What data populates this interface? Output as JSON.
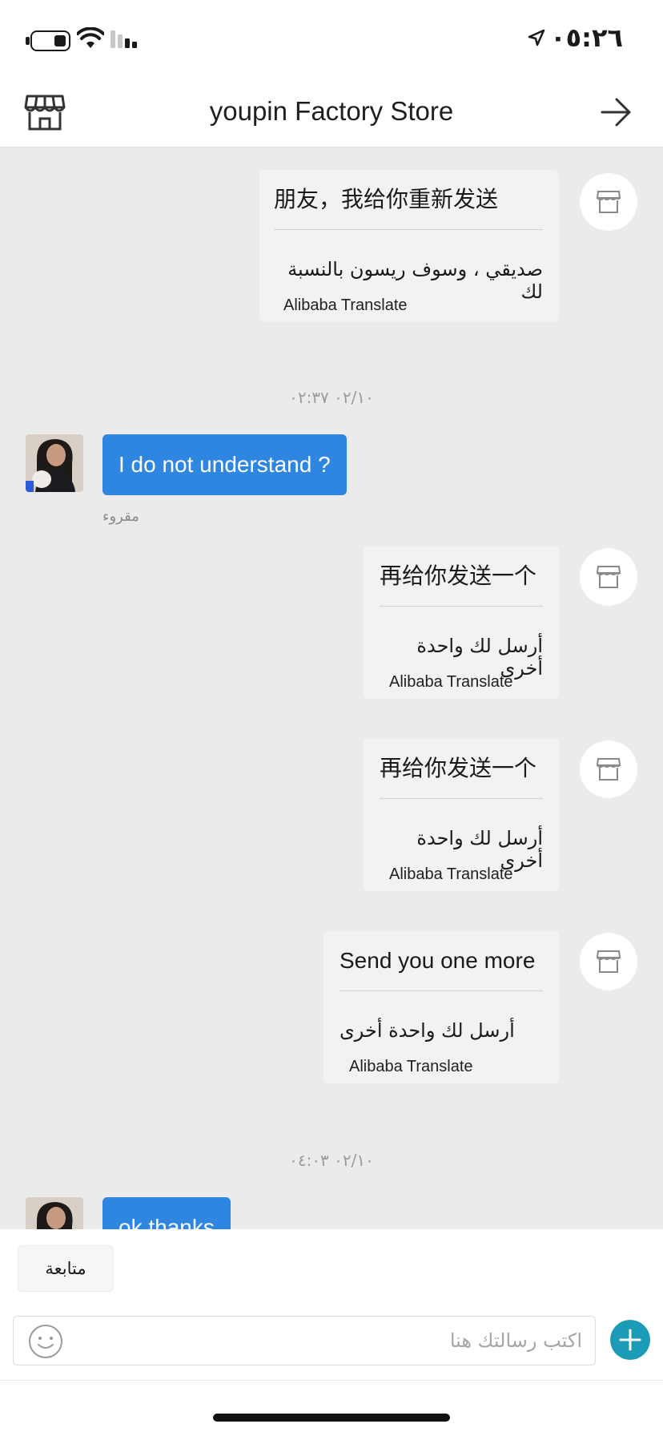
{
  "status_bar": {
    "time": "٠٥:٢٦"
  },
  "header": {
    "title": "youpin Factory Store"
  },
  "messages": [
    {
      "original": "朋友，我给你重新发送",
      "translation": "صديقي ، وسوف ريسون بالنسبة لك",
      "source": "Alibaba Translate"
    },
    {
      "original": "再给你发送一个",
      "translation": "أرسل لك واحدة أخرى",
      "source": "Alibaba Translate"
    },
    {
      "original": "再给你发送一个",
      "translation": "أرسل لك واحدة أخرى",
      "source": "Alibaba Translate"
    },
    {
      "original": "Send you one more",
      "translation": "أرسل لك واحدة أخرى",
      "source": "Alibaba Translate"
    }
  ],
  "timestamps": [
    "٠٢/١٠ ٠٢:٣٧",
    "٠٢/١٠ ٠٤:٠٣"
  ],
  "outgoing": [
    {
      "text": "I do not understand ?",
      "status": "مقروء"
    },
    {
      "text": "ok thanks"
    }
  ],
  "composer": {
    "follow_label": "متابعة",
    "placeholder": "اكتب رسالتك هنا"
  },
  "colors": {
    "outgoing_bubble": "#2f86e1",
    "send_button": "#1b9bb5",
    "chat_background": "#ebebeb"
  }
}
